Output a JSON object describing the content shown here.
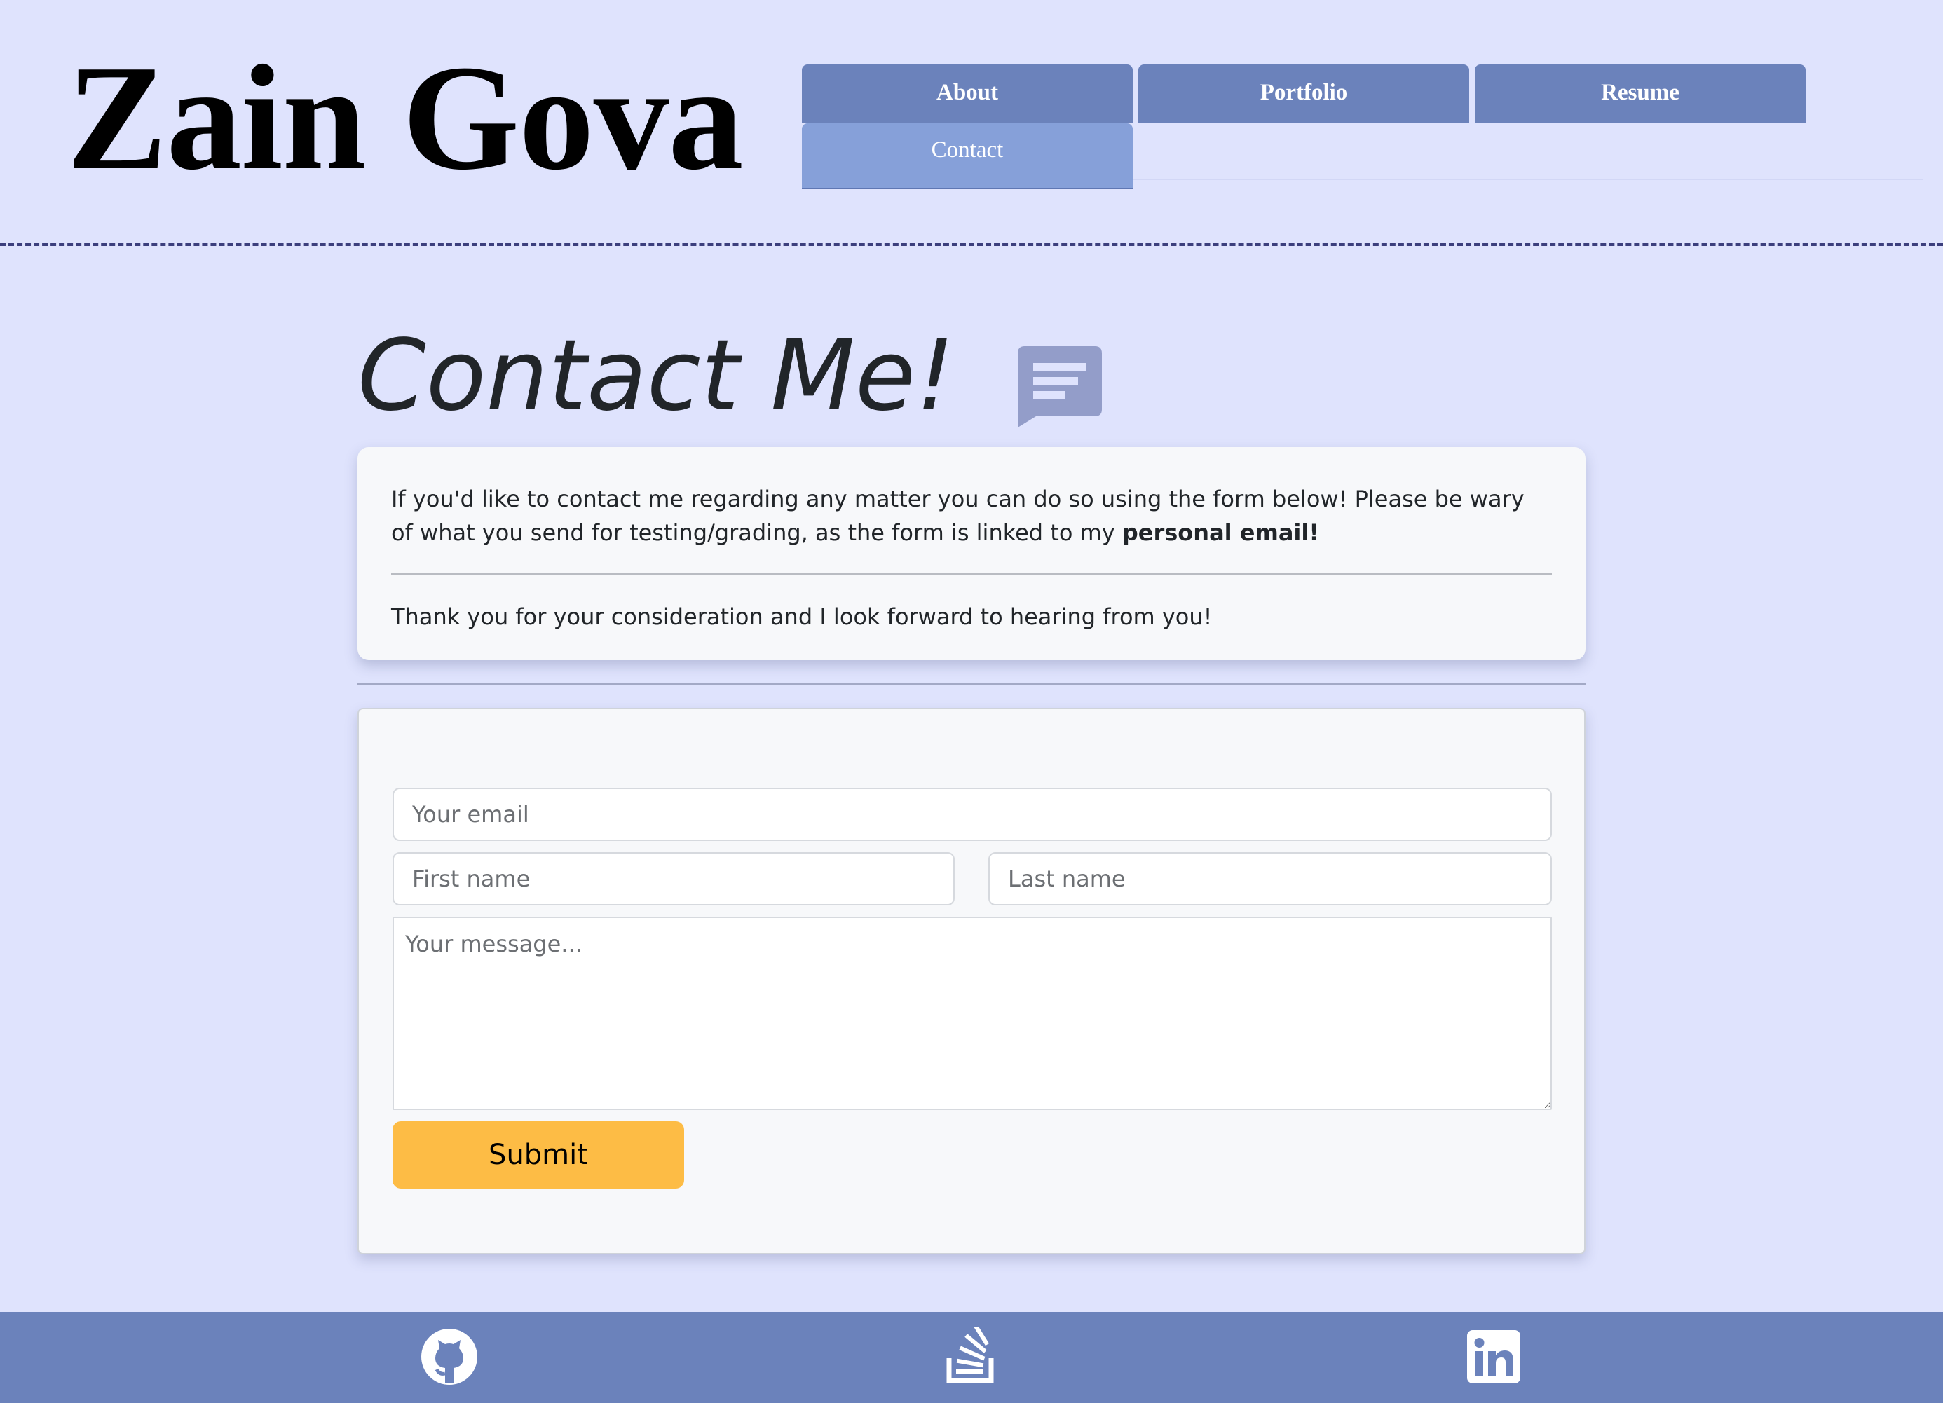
{
  "header": {
    "site_title": "Zain Gova",
    "nav": [
      {
        "label": "About",
        "active": false
      },
      {
        "label": "Portfolio",
        "active": false
      },
      {
        "label": "Resume",
        "active": false
      },
      {
        "label": "Contact",
        "active": true
      }
    ]
  },
  "main": {
    "heading": "Contact Me!",
    "heading_icon": "chat-message-icon",
    "intro": {
      "text_before_bold": "If you'd like to contact me regarding any matter you can do so using the form below! Please be wary of what you send for testing/grading, as the form is linked to my ",
      "text_bold": "personal email!",
      "thanks": "Thank you for your consideration and I look forward to hearing from you!"
    },
    "form": {
      "email_placeholder": "Your email",
      "first_name_placeholder": "First name",
      "last_name_placeholder": "Last name",
      "message_placeholder": "Your message...",
      "submit_label": "Submit"
    }
  },
  "footer": {
    "links": [
      {
        "icon": "github-icon"
      },
      {
        "icon": "stackoverflow-icon"
      },
      {
        "icon": "linkedin-icon"
      }
    ]
  },
  "colors": {
    "page_background": "#dfe3fd",
    "nav_tab": "#6b82bb",
    "nav_tab_active": "#86a0d9",
    "card_background": "#f7f8fa",
    "submit_button": "#fdbc45",
    "footer": "#6b82bb",
    "chat_icon": "#939dc9"
  }
}
